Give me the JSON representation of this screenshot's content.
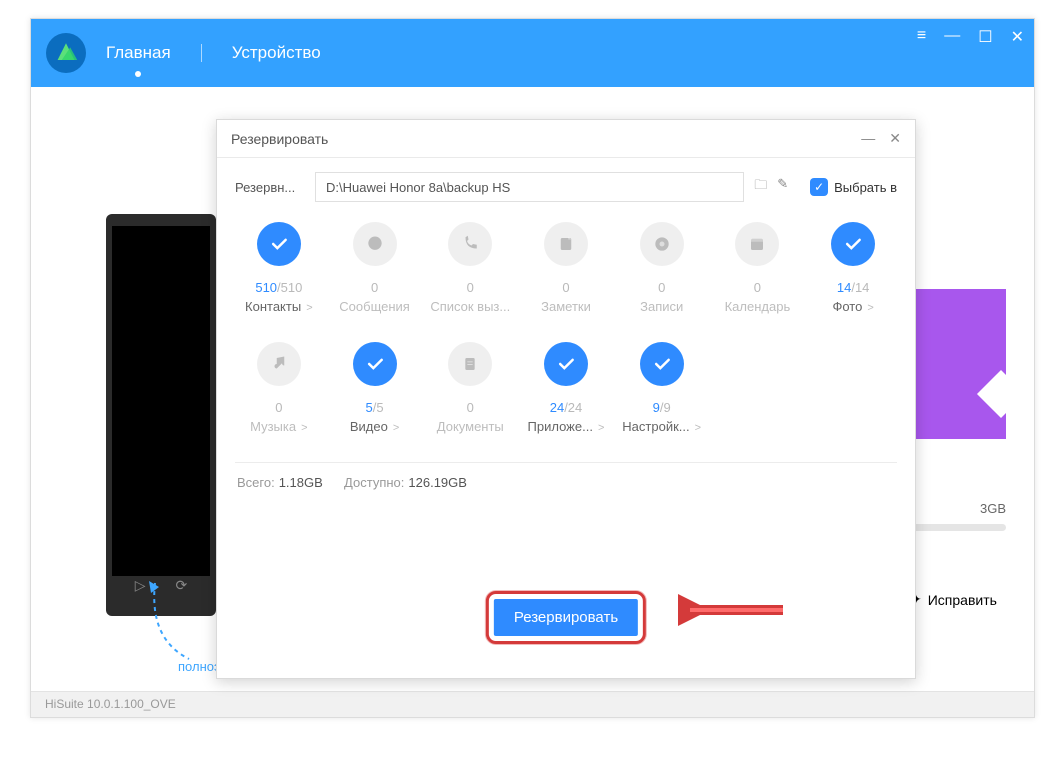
{
  "window": {
    "menu_icon": "≡",
    "min": "—",
    "max": "☐",
    "close": "✕"
  },
  "nav": {
    "main": "Главная",
    "device": "Устройство"
  },
  "hint_text": "полноэкранной",
  "status": "HiSuite 10.0.1.100_OVE",
  "right": {
    "storage": "3GB",
    "fix": "Исправить"
  },
  "modal": {
    "title": "Резервировать",
    "path_label": "Резервн...",
    "path_value": "D:\\Huawei Honor 8a\\backup HS",
    "select_all": "Выбрать в",
    "categories": [
      {
        "selected": true,
        "icon": "check",
        "count_sel": "510",
        "count_tot": "/510",
        "label": "Контакты",
        "has_chevron": true,
        "dim": false
      },
      {
        "selected": false,
        "icon": "bubble",
        "count_sel": "",
        "count_tot": "0",
        "label": "Сообщения",
        "has_chevron": false,
        "dim": true
      },
      {
        "selected": false,
        "icon": "phone",
        "count_sel": "",
        "count_tot": "0",
        "label": "Список выз...",
        "has_chevron": false,
        "dim": true
      },
      {
        "selected": false,
        "icon": "note",
        "count_sel": "",
        "count_tot": "0",
        "label": "Заметки",
        "has_chevron": false,
        "dim": true
      },
      {
        "selected": false,
        "icon": "rec",
        "count_sel": "",
        "count_tot": "0",
        "label": "Записи",
        "has_chevron": false,
        "dim": true
      },
      {
        "selected": false,
        "icon": "cal",
        "count_sel": "",
        "count_tot": "0",
        "label": "Календарь",
        "has_chevron": false,
        "dim": true
      },
      {
        "selected": true,
        "icon": "check",
        "count_sel": "14",
        "count_tot": "/14",
        "label": "Фото",
        "has_chevron": true,
        "dim": false
      },
      {
        "selected": false,
        "icon": "music",
        "count_sel": "",
        "count_tot": "0",
        "label": "Музыка",
        "has_chevron": true,
        "dim": true
      },
      {
        "selected": true,
        "icon": "check",
        "count_sel": "5",
        "count_tot": "/5",
        "label": "Видео",
        "has_chevron": true,
        "dim": false
      },
      {
        "selected": false,
        "icon": "doc",
        "count_sel": "",
        "count_tot": "0",
        "label": "Документы",
        "has_chevron": false,
        "dim": true
      },
      {
        "selected": true,
        "icon": "check",
        "count_sel": "24",
        "count_tot": "/24",
        "label": "Приложе...",
        "has_chevron": true,
        "dim": false
      },
      {
        "selected": true,
        "icon": "check",
        "count_sel": "9",
        "count_tot": "/9",
        "label": "Настройк...",
        "has_chevron": true,
        "dim": false
      }
    ],
    "totals": {
      "total_label": "Всего:",
      "total_value": "1.18GB",
      "avail_label": "Доступно:",
      "avail_value": "126.19GB"
    },
    "button": "Резервировать"
  }
}
